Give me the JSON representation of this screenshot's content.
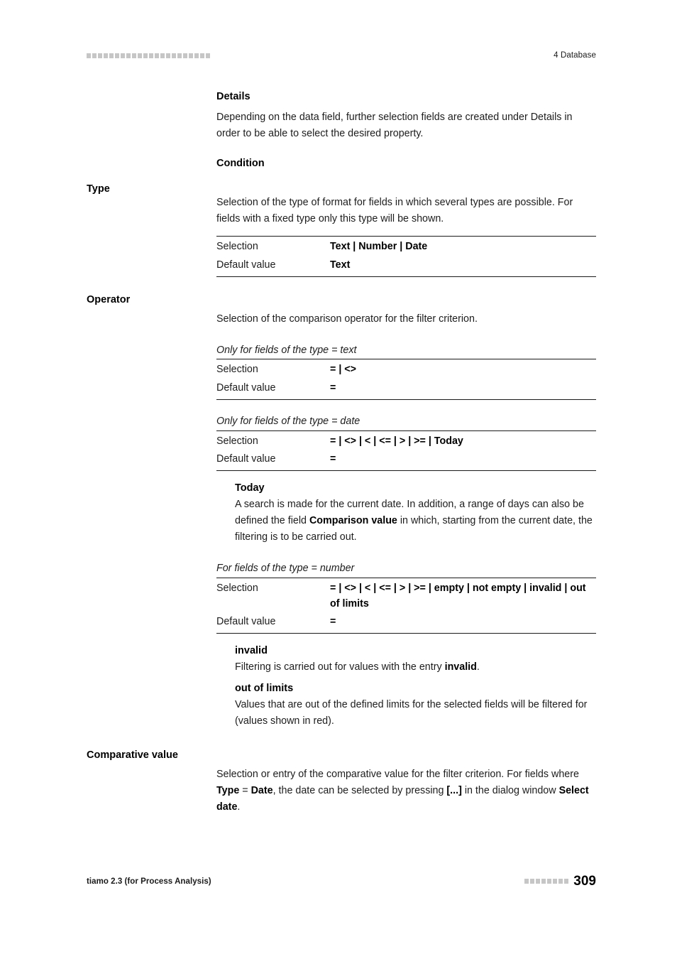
{
  "header": {
    "marker_squares": 22,
    "title": "4 Database"
  },
  "sections": {
    "details": {
      "heading": "Details",
      "paragraph": "Depending on the data field, further selection fields are created under Details in order to be able to select the desired property."
    },
    "condition": {
      "heading": "Condition"
    },
    "type": {
      "margin_label": "Type",
      "paragraph": "Selection of the type of format for fields in which several types are possible. For fields with a fixed type only this type will be shown.",
      "table": {
        "rows": [
          {
            "key": "Selection",
            "value": "Text | Number | Date"
          },
          {
            "key": "Default value",
            "value": "Text"
          }
        ]
      }
    },
    "operator": {
      "margin_label": "Operator",
      "paragraph": "Selection of the comparison operator for the filter criterion.",
      "text_table": {
        "caption": "Only for fields of the type = text",
        "rows": [
          {
            "key": "Selection",
            "value": "= | <>"
          },
          {
            "key": "Default value",
            "value": "="
          }
        ]
      },
      "date_table": {
        "caption": "Only for fields of the type = date",
        "rows": [
          {
            "key": "Selection",
            "value": "= | <> | < | <= | > | >= | Today"
          },
          {
            "key": "Default value",
            "value": "="
          }
        ]
      },
      "today_block": {
        "term": "Today",
        "text_1": "A search is made for the current date. In addition, a range of days can also be defined the field ",
        "text_bold": "Comparison value",
        "text_2": " in which, starting from the current date, the filtering is to be carried out."
      },
      "number_table": {
        "caption": "For fields of the type = number",
        "rows": [
          {
            "key": "Selection",
            "value": "= | <> | < | <= | > | >= | empty | not empty | invalid | out of limits"
          },
          {
            "key": "Default value",
            "value": "="
          }
        ]
      },
      "invalid_block": {
        "term": "invalid",
        "text_1": "Filtering is carried out for values with the entry ",
        "text_bold": "invalid",
        "text_2": "."
      },
      "outoflimits_block": {
        "term": "out of limits",
        "text": "Values that are out of the defined limits for the selected fields will be filtered for (values shown in red)."
      }
    },
    "comparative_value": {
      "margin_label": "Comparative value",
      "text_1": "Selection or entry of the comparative value for the filter criterion. For fields where ",
      "bold_type": "Type",
      "text_2": " = ",
      "bold_date": "Date",
      "text_3": ", the date can be selected by pressing ",
      "bold_brackets": "[...]",
      "text_4": " in the dialog window ",
      "bold_selectdate": "Select date",
      "text_5": "."
    }
  },
  "footer": {
    "product": "tiamo 2.3 (for Process Analysis)",
    "marker_squares": 8,
    "page_number": "309"
  }
}
